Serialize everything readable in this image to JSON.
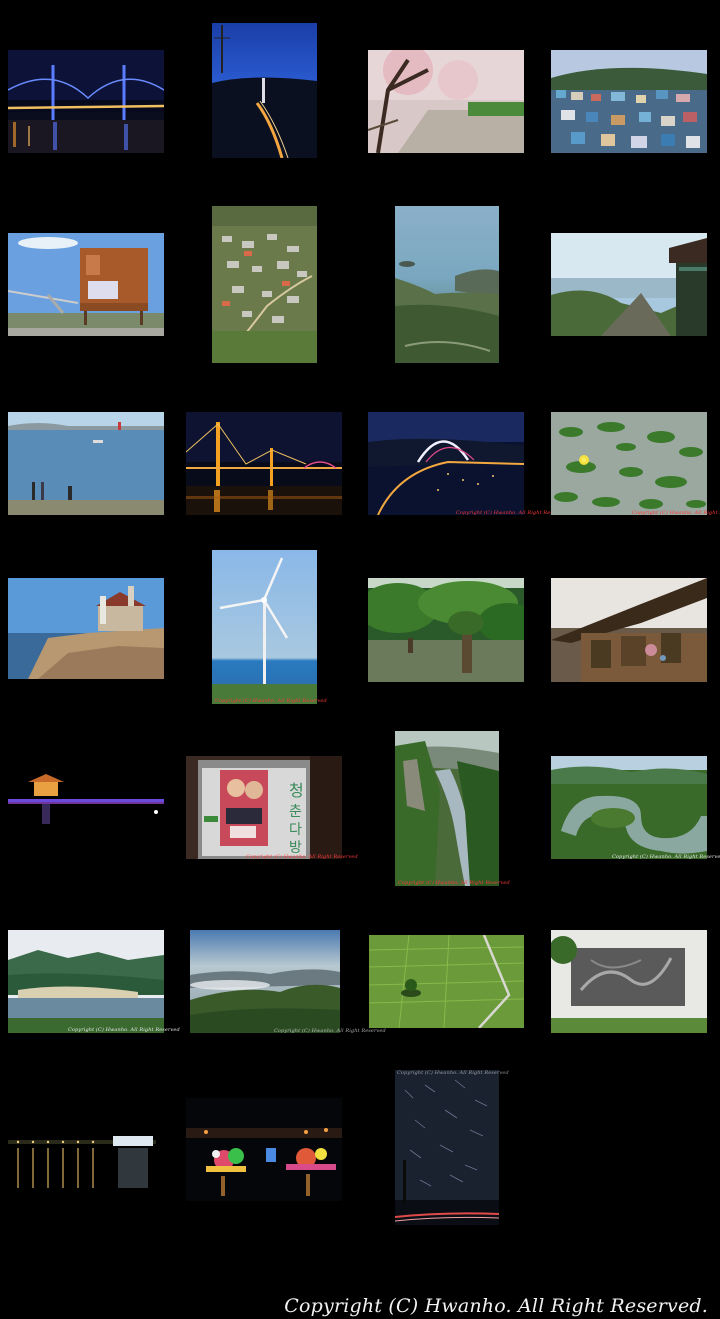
{
  "gallery": {
    "footer_copyright": "Copyright (C) Hwanho. All Right Reserved.",
    "photo_watermark": "Copyright (C) Hwanho. All Right Reserved",
    "photos": [
      {
        "subject": "suspension bridge at night"
      },
      {
        "subject": "bridge and road at dusk"
      },
      {
        "subject": "cherry blossom path"
      },
      {
        "subject": "hillside village of colorful houses"
      },
      {
        "subject": "brick observation tower"
      },
      {
        "subject": "island village from above"
      },
      {
        "subject": "misty bay view"
      },
      {
        "subject": "temple over sea view"
      },
      {
        "subject": "beach with people"
      },
      {
        "subject": "lit cable bridge at night"
      },
      {
        "subject": "arch bridge at night"
      },
      {
        "subject": "water lilies"
      },
      {
        "subject": "seaside chapel"
      },
      {
        "subject": "wind turbine"
      },
      {
        "subject": "trees in marsh"
      },
      {
        "subject": "traditional pavilion roof"
      },
      {
        "subject": "lit pavilion at night"
      },
      {
        "subject": "poster on building"
      },
      {
        "subject": "river cliffs"
      },
      {
        "subject": "river bend"
      },
      {
        "subject": "lake with mountains"
      },
      {
        "subject": "mountain ridges in mist"
      },
      {
        "subject": "green rice fields"
      },
      {
        "subject": "stone relief wall"
      },
      {
        "subject": "harbor lights at night"
      },
      {
        "subject": "lantern festival"
      },
      {
        "subject": "star trails"
      }
    ]
  }
}
